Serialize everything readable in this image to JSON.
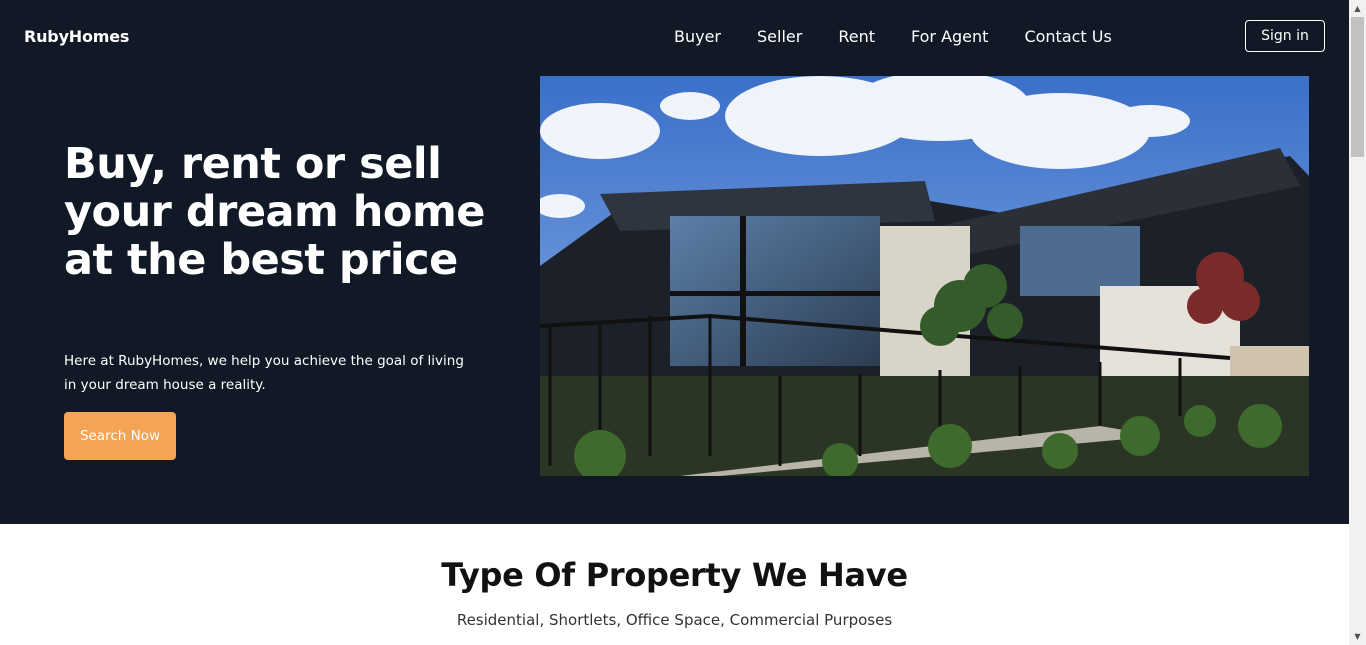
{
  "header": {
    "logo": "RubyHomes",
    "nav": [
      "Buyer",
      "Seller",
      "Rent",
      "For Agent",
      "Contact Us"
    ],
    "sign_in": "Sign in"
  },
  "hero": {
    "headline": "Buy, rent or sell your dream home at the best price",
    "subtext": "Here at RubyHomes, we help you achieve the goal of living in your dream house a reality.",
    "cta": "Search Now"
  },
  "section": {
    "title": "Type Of Property We Have",
    "subtitle": "Residential, Shortlets, Office Space, Commercial Purposes"
  },
  "colors": {
    "hero_bg": "#111927",
    "accent": "#f5a455",
    "text_light": "#ffffff"
  }
}
